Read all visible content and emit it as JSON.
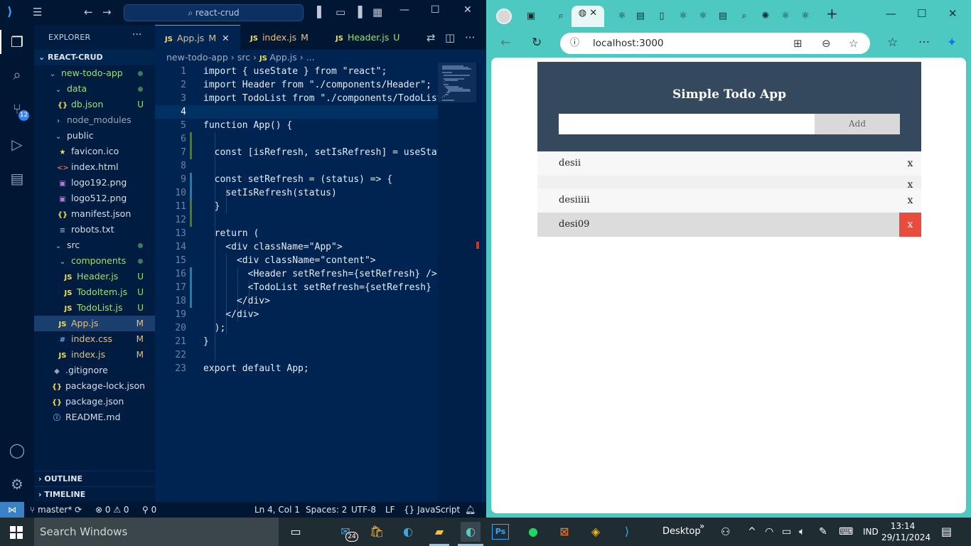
{
  "vscode": {
    "search_placeholder": "react-crud",
    "explorer_title": "EXPLORER",
    "explorer_more": "···",
    "project_name": "REACT-CRUD",
    "scm_badge": "12",
    "tree": [
      {
        "label": "new-todo-app",
        "status": ""
      },
      {
        "label": "data",
        "status": ""
      },
      {
        "label": "db.json",
        "status": "U"
      },
      {
        "label": "node_modules",
        "status": ""
      },
      {
        "label": "public",
        "status": ""
      },
      {
        "label": "favicon.ico",
        "status": ""
      },
      {
        "label": "index.html",
        "status": ""
      },
      {
        "label": "logo192.png",
        "status": ""
      },
      {
        "label": "logo512.png",
        "status": ""
      },
      {
        "label": "manifest.json",
        "status": ""
      },
      {
        "label": "robots.txt",
        "status": ""
      },
      {
        "label": "src",
        "status": ""
      },
      {
        "label": "components",
        "status": ""
      },
      {
        "label": "Header.js",
        "status": "U"
      },
      {
        "label": "TodoItem.js",
        "status": "U"
      },
      {
        "label": "TodoList.js",
        "status": "U"
      },
      {
        "label": "App.js",
        "status": "M"
      },
      {
        "label": "index.css",
        "status": "M"
      },
      {
        "label": "index.js",
        "status": "M"
      },
      {
        "label": ".gitignore",
        "status": ""
      },
      {
        "label": "package-lock.json",
        "status": ""
      },
      {
        "label": "package.json",
        "status": ""
      },
      {
        "label": "README.md",
        "status": ""
      }
    ],
    "outline_label": "OUTLINE",
    "timeline_label": "TIMELINE",
    "tabs": [
      {
        "label": "App.js",
        "status": "M"
      },
      {
        "label": "index.js",
        "status": "M"
      },
      {
        "label": "Header.js",
        "status": "U"
      }
    ],
    "breadcrumb": [
      "new-todo-app",
      "src",
      "App.js",
      "..."
    ],
    "code_lines": [
      "import { useState } from \"react\";",
      "import Header from \"./components/Header\";",
      "import TodoList from \"./components/TodoList\";",
      "",
      "function App() {",
      "",
      "  const [isRefresh, setIsRefresh] = useStat",
      "",
      "  const setRefresh = (status) => {",
      "    setIsRefresh(status)",
      "  }",
      "",
      "  return (",
      "    <div className=\"App\">",
      "      <div className=\"content\">",
      "        <Header setRefresh={setRefresh} />",
      "        <TodoList setRefresh={setRefresh} i",
      "      </div>",
      "    </div>",
      "  );",
      "}",
      "",
      "export default App;"
    ],
    "status": {
      "branch": "master*",
      "errors": "0",
      "warnings": "0",
      "ports": "0",
      "position": "Ln 4, Col 1",
      "spaces": "Spaces: 2",
      "encoding": "UTF-8",
      "eol": "LF",
      "language": "JavaScript"
    }
  },
  "browser": {
    "url": "localhost:3000",
    "app": {
      "title": "Simple Todo App",
      "input_value": "",
      "add_label": "Add",
      "items": [
        {
          "text": "desii",
          "delete": "x"
        },
        {
          "text": "",
          "delete": "x"
        },
        {
          "text": "desiiiii",
          "delete": "x"
        },
        {
          "text": "desi09",
          "delete": "x"
        }
      ]
    }
  },
  "taskbar": {
    "search_placeholder": "Search Windows",
    "mail_badge": "24",
    "desktop_label": "Desktop",
    "language": "IND",
    "time": "13:14",
    "date": "29/11/2024"
  },
  "colors": {
    "editor_bg": "#002451",
    "todo_header": "#34495e",
    "delete_hover": "#e74c3c",
    "browser_frame": "#4ec9c1"
  }
}
